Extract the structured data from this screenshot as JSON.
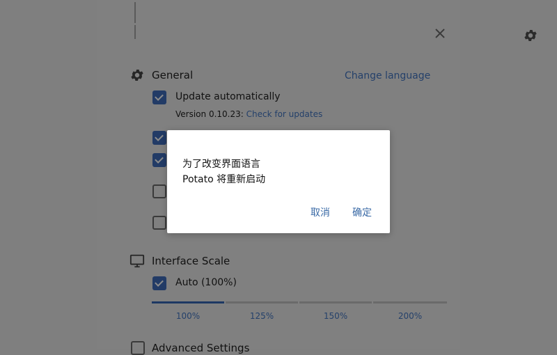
{
  "general": {
    "title": "General",
    "change_language": "Change language",
    "update_auto_label": "Update automatically",
    "version_prefix": "Version 0.10.23:",
    "check_updates": "Check for updates",
    "option_states": [
      true,
      true,
      true,
      false,
      false
    ]
  },
  "interface_scale": {
    "title": "Interface Scale",
    "auto_label": "Auto (100%)",
    "auto_checked": true,
    "options": [
      "100%",
      "125%",
      "150%",
      "200%"
    ],
    "selected_index": 0
  },
  "advanced": {
    "title": "Advanced Settings"
  },
  "dialog": {
    "line1": "为了改变界面语言",
    "line2": "Potato 将重新启动",
    "cancel": "取消",
    "ok": "确定"
  },
  "icons": [
    "gear-icon",
    "close-icon",
    "monitor-icon"
  ]
}
